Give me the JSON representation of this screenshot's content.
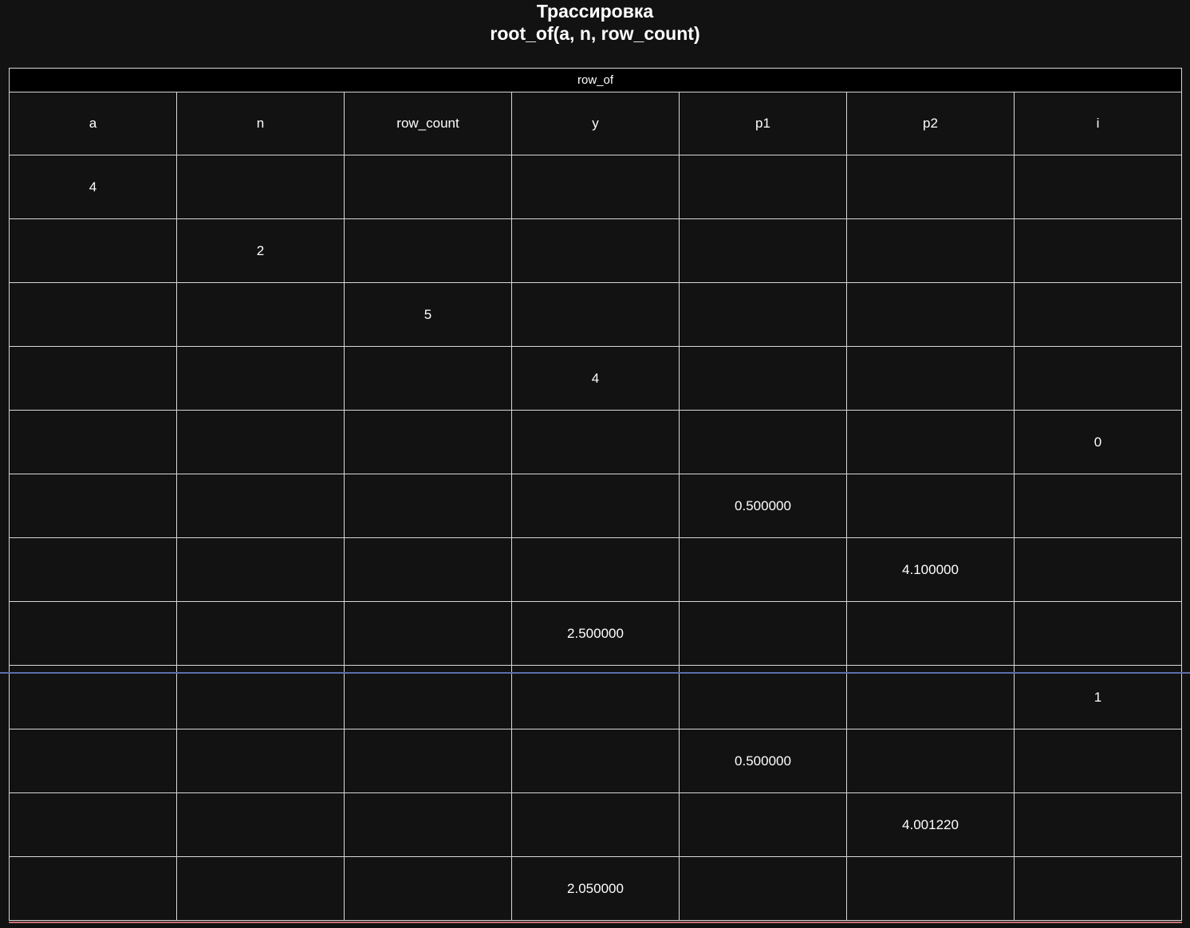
{
  "title": {
    "line1": "Трассировка",
    "line2": "root_of(a, n, row_count)"
  },
  "table": {
    "caption": "row_of",
    "columns": [
      "a",
      "n",
      "row_count",
      "y",
      "p1",
      "p2",
      "i"
    ],
    "rows": [
      [
        "4",
        "",
        "",
        "",
        "",
        "",
        ""
      ],
      [
        "",
        "2",
        "",
        "",
        "",
        "",
        ""
      ],
      [
        "",
        "",
        "5",
        "",
        "",
        "",
        ""
      ],
      [
        "",
        "",
        "",
        "4",
        "",
        "",
        ""
      ],
      [
        "",
        "",
        "",
        "",
        "",
        "",
        "0"
      ],
      [
        "",
        "",
        "",
        "",
        "0.500000",
        "",
        ""
      ],
      [
        "",
        "",
        "",
        "",
        "",
        "4.100000",
        ""
      ],
      [
        "",
        "",
        "",
        "2.500000",
        "",
        "",
        ""
      ],
      [
        "",
        "",
        "",
        "",
        "",
        "",
        "1"
      ],
      [
        "",
        "",
        "",
        "",
        "0.500000",
        "",
        ""
      ],
      [
        "",
        "",
        "",
        "",
        "",
        "4.001220",
        ""
      ],
      [
        "",
        "",
        "",
        "2.050000",
        "",
        "",
        ""
      ]
    ]
  },
  "colors": {
    "background": "#121212",
    "caption_background": "#000000",
    "grid": "#d8d8d8",
    "divider_blue": "#5a6fa8",
    "divider_red": "#c87070"
  }
}
